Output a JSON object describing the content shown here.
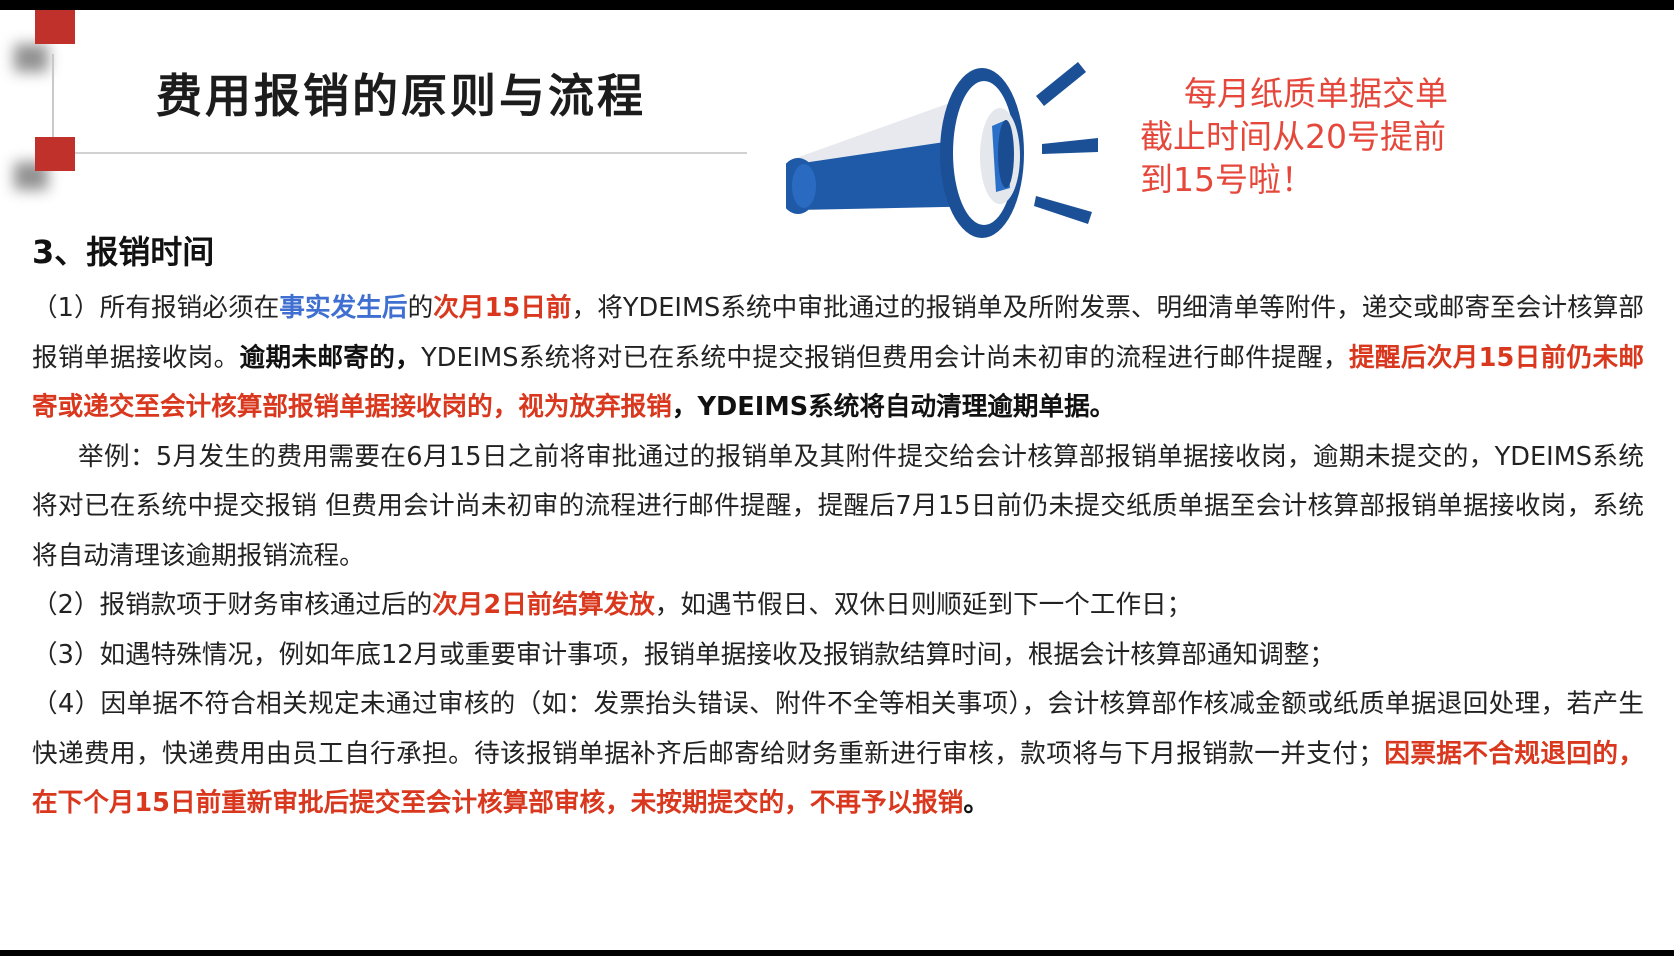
{
  "slide": {
    "title": "费用报销的原则与流程",
    "notice": {
      "line1": "每月纸质单据交单",
      "line2": "截止时间从20号提前",
      "line3": "到15号啦！"
    },
    "section_heading": "3、报销时间",
    "colors": {
      "accent_red": "#c0312b",
      "highlight_red": "#d9381e",
      "highlight_blue": "#3f6fd0",
      "notice_red": "#e5473b",
      "megaphone_blue": "#1f5aa8"
    },
    "icons": [
      "megaphone-icon"
    ],
    "p1": {
      "a": "（1）所有报销必须在",
      "b": "事实发生后",
      "c": "的",
      "d": "次月15日前",
      "e": "，将YDEIMS系统中审批通过的报销单及所附发票、明细清单等附件，递交或邮寄至会计核算部报销单据接收岗。",
      "f": "逾期未邮寄的，",
      "g": "YDEIMS系统将对已在系统中提交报销但费用会计尚未初审的流程进行邮件提醒，",
      "h": "提醒后次月15日前仍未邮寄或递交至会计核算部报销单据接收岗的，视为放弃报销",
      "i": "，YDEIMS系统将自动清理逾期单据。"
    },
    "example": "举例：5月发生的费用需要在6月15日之前将审批通过的报销单及其附件提交给会计核算部报销单据接收岗，逾期未提交的，YDEIMS系统将对已在系统中提交报销 但费用会计尚未初审的流程进行邮件提醒，提醒后7月15日前仍未提交纸质单据至会计核算部报销单据接收岗，系统将自动清理该逾期报销流程。",
    "p2": {
      "a": "（2）报销款项于财务审核通过后的",
      "b": "次月2日前结算发放",
      "c": "，如遇节假日、双休日则顺延到下一个工作日；"
    },
    "p3": "（3）如遇特殊情况，例如年底12月或重要审计事项，报销单据接收及报销款结算时间，根据会计核算部通知调整；",
    "p4": {
      "a": "（4）因单据不符合相关规定未通过审核的（如：发票抬头错误、附件不全等相关事项），会计核算部作核减金额或纸质单据退回处理，若产生快递费用，快递费用由员工自行承担。待该报销单据补齐后邮寄给财务重新进行审核，款项将与下月报销款一并支付；",
      "b": "因票据不合规退回的，在下个月15日前重新审批后提交至会计核算部审核，未按期提交的，不再予以报销",
      "c": "。"
    }
  }
}
